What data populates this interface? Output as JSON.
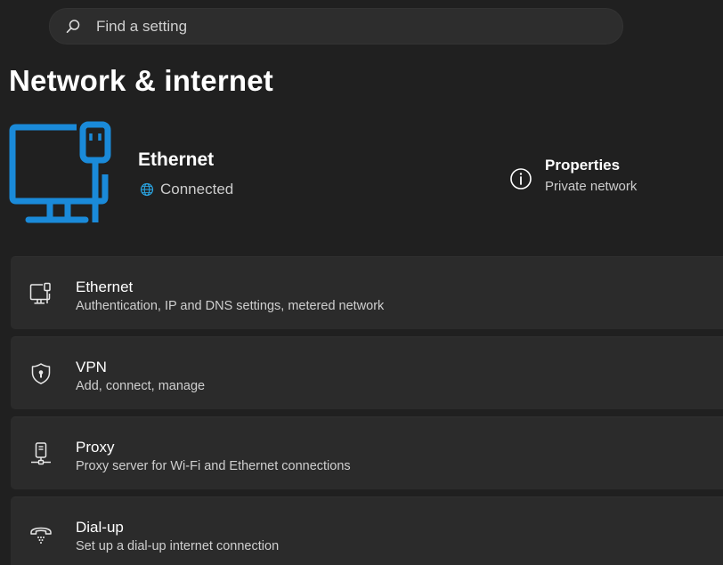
{
  "search": {
    "placeholder": "Find a setting",
    "icon": "search-icon"
  },
  "page": {
    "title": "Network & internet"
  },
  "hero": {
    "icon": "ethernet-monitor-icon",
    "name": "Ethernet",
    "status": "Connected",
    "status_icon": "globe-icon",
    "accent": "#1a8ad9"
  },
  "properties": {
    "icon": "info-icon",
    "label": "Properties",
    "value": "Private network"
  },
  "cards": [
    {
      "icon": "ethernet-icon",
      "title": "Ethernet",
      "subtitle": "Authentication, IP and DNS settings, metered network"
    },
    {
      "icon": "vpn-shield-icon",
      "title": "VPN",
      "subtitle": "Add, connect, manage"
    },
    {
      "icon": "proxy-icon",
      "title": "Proxy",
      "subtitle": "Proxy server for Wi-Fi and Ethernet connections"
    },
    {
      "icon": "dial-up-icon",
      "title": "Dial-up",
      "subtitle": "Set up a dial-up internet connection"
    }
  ],
  "colors": {
    "background": "#202020",
    "card": "#2b2b2b",
    "accent": "#1a8ad9",
    "text_secondary": "#cccccc"
  }
}
